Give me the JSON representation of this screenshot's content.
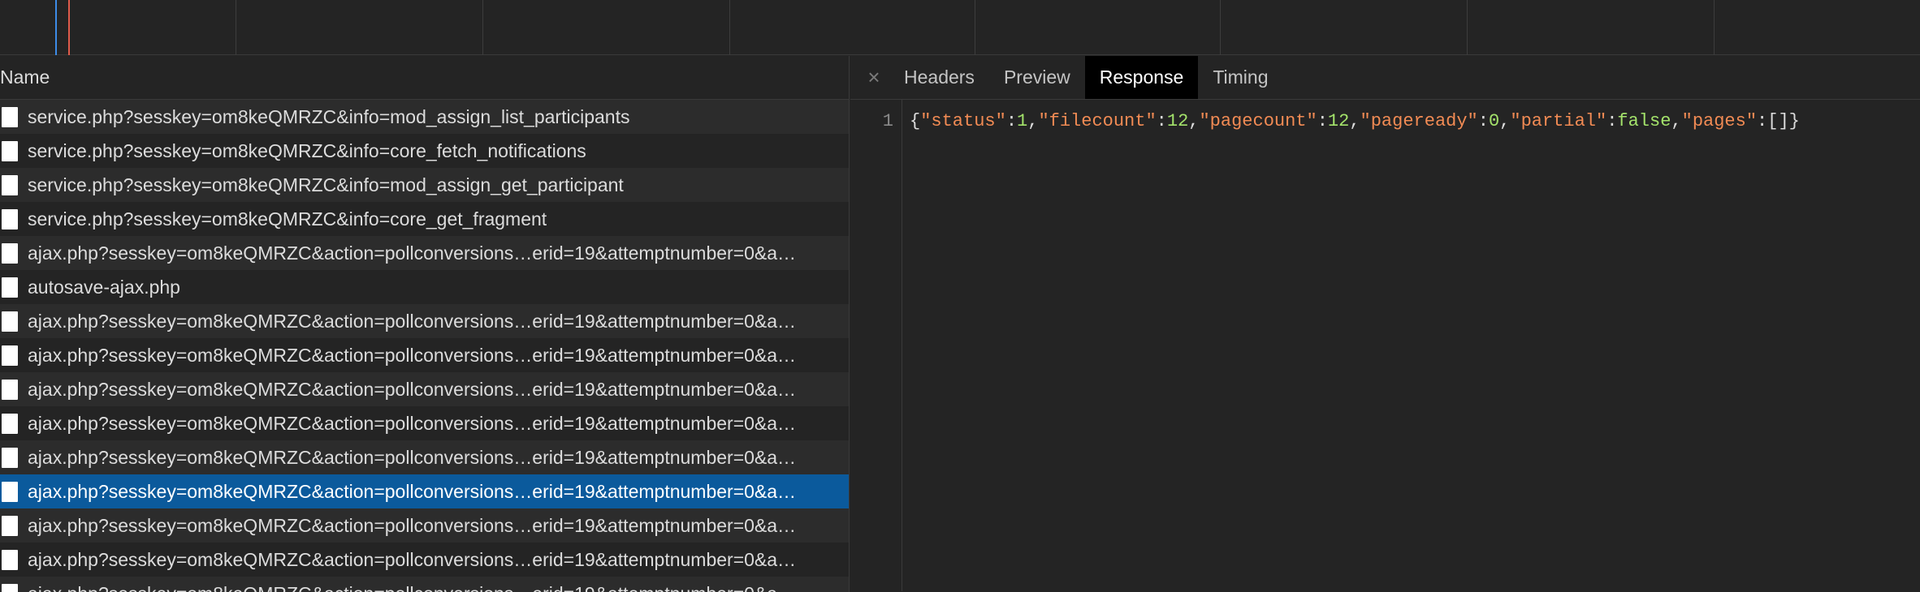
{
  "timeline": {
    "colors": {
      "dom_content_loaded": "#3d8ce8",
      "load": "#e05b4a",
      "grid": "#3d3d3d"
    }
  },
  "list": {
    "header": "Name",
    "rows": [
      {
        "label": "service.php?sesskey=om8keQMRZC&info=mod_assign_list_participants",
        "selected": false
      },
      {
        "label": "service.php?sesskey=om8keQMRZC&info=core_fetch_notifications",
        "selected": false
      },
      {
        "label": "service.php?sesskey=om8keQMRZC&info=mod_assign_get_participant",
        "selected": false
      },
      {
        "label": "service.php?sesskey=om8keQMRZC&info=core_get_fragment",
        "selected": false
      },
      {
        "label": "ajax.php?sesskey=om8keQMRZC&action=pollconversions…erid=19&attemptnumber=0&a…",
        "selected": false
      },
      {
        "label": "autosave-ajax.php",
        "selected": false
      },
      {
        "label": "ajax.php?sesskey=om8keQMRZC&action=pollconversions…erid=19&attemptnumber=0&a…",
        "selected": false
      },
      {
        "label": "ajax.php?sesskey=om8keQMRZC&action=pollconversions…erid=19&attemptnumber=0&a…",
        "selected": false
      },
      {
        "label": "ajax.php?sesskey=om8keQMRZC&action=pollconversions…erid=19&attemptnumber=0&a…",
        "selected": false
      },
      {
        "label": "ajax.php?sesskey=om8keQMRZC&action=pollconversions…erid=19&attemptnumber=0&a…",
        "selected": false
      },
      {
        "label": "ajax.php?sesskey=om8keQMRZC&action=pollconversions…erid=19&attemptnumber=0&a…",
        "selected": false
      },
      {
        "label": "ajax.php?sesskey=om8keQMRZC&action=pollconversions…erid=19&attemptnumber=0&a…",
        "selected": true
      },
      {
        "label": "ajax.php?sesskey=om8keQMRZC&action=pollconversions…erid=19&attemptnumber=0&a…",
        "selected": false
      },
      {
        "label": "ajax.php?sesskey=om8keQMRZC&action=pollconversions…erid=19&attemptnumber=0&a…",
        "selected": false
      },
      {
        "label": "ajax.php?sesskey=om8keQMRZC&action=pollconversions…erid=19&attemptnumber=0&a…",
        "selected": false
      }
    ],
    "file_icon": "file-icon"
  },
  "detail": {
    "close_icon": "×",
    "tabs": [
      {
        "label": "Headers",
        "active": false
      },
      {
        "label": "Preview",
        "active": false
      },
      {
        "label": "Response",
        "active": true
      },
      {
        "label": "Timing",
        "active": false
      }
    ],
    "response": {
      "line_number": "1",
      "tokens": [
        {
          "t": "punc",
          "v": "{"
        },
        {
          "t": "key",
          "v": "\"status\""
        },
        {
          "t": "punc",
          "v": ":"
        },
        {
          "t": "num",
          "v": "1"
        },
        {
          "t": "punc",
          "v": ","
        },
        {
          "t": "key",
          "v": "\"filecount\""
        },
        {
          "t": "punc",
          "v": ":"
        },
        {
          "t": "num",
          "v": "12"
        },
        {
          "t": "punc",
          "v": ","
        },
        {
          "t": "key",
          "v": "\"pagecount\""
        },
        {
          "t": "punc",
          "v": ":"
        },
        {
          "t": "num",
          "v": "12"
        },
        {
          "t": "punc",
          "v": ","
        },
        {
          "t": "key",
          "v": "\"pageready\""
        },
        {
          "t": "punc",
          "v": ":"
        },
        {
          "t": "num",
          "v": "0"
        },
        {
          "t": "punc",
          "v": ","
        },
        {
          "t": "key",
          "v": "\"partial\""
        },
        {
          "t": "punc",
          "v": ":"
        },
        {
          "t": "bool",
          "v": "false"
        },
        {
          "t": "punc",
          "v": ","
        },
        {
          "t": "key",
          "v": "\"pages\""
        },
        {
          "t": "punc",
          "v": ":[]}"
        }
      ]
    }
  }
}
